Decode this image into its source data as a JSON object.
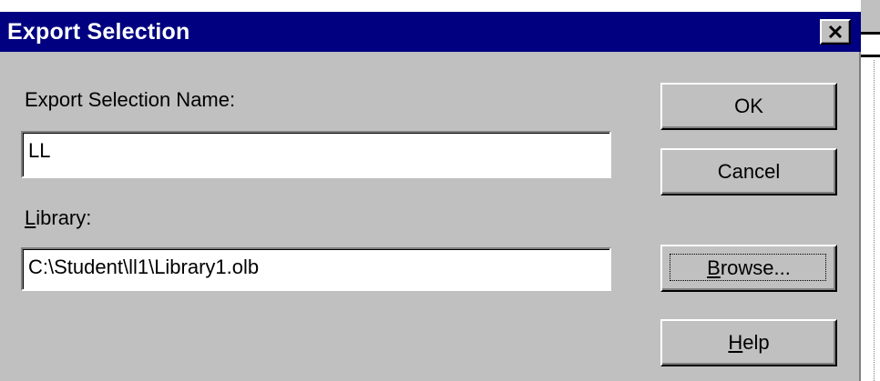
{
  "dialog": {
    "title": "Export Selection",
    "close_icon": "close-icon",
    "name_label": "Export Selection Name:",
    "name_value": "LL",
    "library_label_accel": "L",
    "library_label_rest": "ibrary:",
    "library_value": "C:\\Student\\ll1\\Library1.olb"
  },
  "buttons": {
    "ok": "OK",
    "cancel": "Cancel",
    "browse_accel": "B",
    "browse_rest": "rowse...",
    "help_accel": "H",
    "help_rest": "elp"
  },
  "colors": {
    "titlebar": "#000080",
    "face": "#c0c0c0"
  }
}
